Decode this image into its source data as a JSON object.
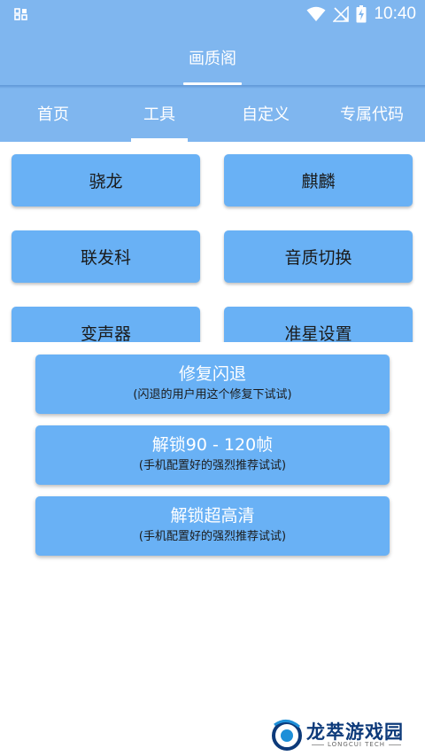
{
  "status_bar": {
    "time": "10:40"
  },
  "app_bar": {
    "title": "画质阁"
  },
  "tabs": [
    {
      "label": "首页"
    },
    {
      "label": "工具",
      "active": true
    },
    {
      "label": "自定义"
    },
    {
      "label": "专属代码"
    }
  ],
  "grid_buttons": [
    {
      "label": "骁龙"
    },
    {
      "label": "麒麟"
    },
    {
      "label": "联发科"
    },
    {
      "label": "音质切换"
    },
    {
      "label": "变声器"
    },
    {
      "label": "准星设置"
    }
  ],
  "wide_buttons": [
    {
      "title": "修复闪退",
      "subtitle": "(闪退的用户用这个修复下试试)"
    },
    {
      "title": "解锁90 - 120帧",
      "subtitle": "(手机配置好的强烈推荐试试)"
    },
    {
      "title": "解锁超高清",
      "subtitle": "(手机配置好的强烈推荐试试)"
    }
  ],
  "watermark": {
    "name": "龙萃游戏园",
    "sub": "LONGCUI TECH"
  },
  "colors": {
    "primary": "#7fb6ef",
    "button": "#69b1f5",
    "text": "#1a1a1a"
  },
  "icons": [
    "screenshot-icon",
    "wifi-icon",
    "no-signal-icon",
    "battery-charging-icon"
  ]
}
